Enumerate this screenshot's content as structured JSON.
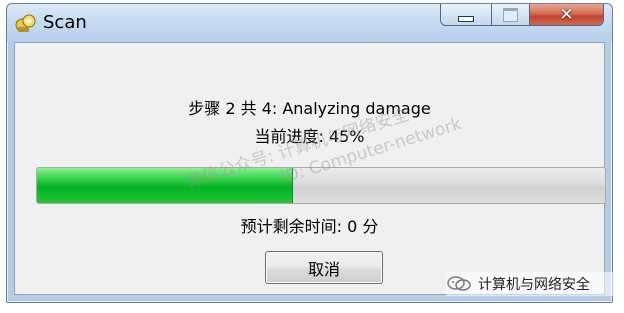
{
  "window": {
    "title": "Scan",
    "icon": "scan-app-icon",
    "controls": {
      "minimize_icon": "minimize-icon",
      "maximize_icon": "maximize-icon",
      "close_icon": "close-icon",
      "close_glyph": "✕"
    }
  },
  "scan": {
    "step_text": "步骤 2 共 4: Analyzing damage",
    "progress_text": "当前进度: 45%",
    "progress_value": 0.45,
    "remaining_text": "预计剩余时间: 0 分",
    "cancel_label": "取消"
  },
  "watermark": {
    "line1": "微信公众号: 计算机与网络安全",
    "line2": "ID: Computer-network"
  },
  "badge": {
    "icon": "wechat-icon",
    "text": "计算机与网络安全"
  },
  "colors": {
    "progress_green": "#06b125",
    "close_red": "#c04530",
    "window_border": "#6a7f98"
  }
}
